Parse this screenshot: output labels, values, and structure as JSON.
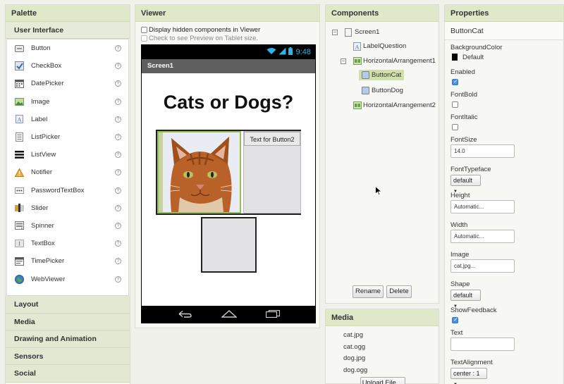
{
  "palette": {
    "title": "Palette",
    "section": "User Interface",
    "items": [
      {
        "label": "Button",
        "icon": "button-icon"
      },
      {
        "label": "CheckBox",
        "icon": "checkbox-icon"
      },
      {
        "label": "DatePicker",
        "icon": "datepicker-icon"
      },
      {
        "label": "Image",
        "icon": "image-icon"
      },
      {
        "label": "Label",
        "icon": "label-icon"
      },
      {
        "label": "ListPicker",
        "icon": "listpicker-icon"
      },
      {
        "label": "ListView",
        "icon": "listview-icon"
      },
      {
        "label": "Notifier",
        "icon": "notifier-icon"
      },
      {
        "label": "PasswordTextBox",
        "icon": "passwordtextbox-icon"
      },
      {
        "label": "Slider",
        "icon": "slider-icon"
      },
      {
        "label": "Spinner",
        "icon": "spinner-icon"
      },
      {
        "label": "TextBox",
        "icon": "textbox-icon"
      },
      {
        "label": "TimePicker",
        "icon": "timepicker-icon"
      },
      {
        "label": "WebViewer",
        "icon": "webviewer-icon"
      }
    ],
    "help_glyph": "?",
    "categories": [
      "Layout",
      "Media",
      "Drawing and Animation",
      "Sensors",
      "Social"
    ]
  },
  "viewer": {
    "title": "Viewer",
    "show_hidden": "Display hidden components in Viewer",
    "tablet_preview": "Check to see Preview on Tablet size.",
    "phone": {
      "time": "9:48",
      "screen_title": "Screen1",
      "question": "Cats or Dogs?",
      "button2_text": "Text for Button2"
    }
  },
  "components": {
    "title": "Components",
    "tree": {
      "screen": "Screen1",
      "label": "LabelQuestion",
      "harr1": "HorizontalArrangement1",
      "btn_cat": "ButtonCat",
      "btn_dog": "ButtonDog",
      "harr2": "HorizontalArrangement2"
    },
    "rename": "Rename",
    "delete": "Delete"
  },
  "media": {
    "title": "Media",
    "files": [
      "cat.jpg",
      "cat.ogg",
      "dog.jpg",
      "dog.ogg"
    ],
    "upload": "Upload File ..."
  },
  "properties": {
    "title": "Properties",
    "component": "ButtonCat",
    "bg_label": "BackgroundColor",
    "bg_value": "Default",
    "enabled_label": "Enabled",
    "fontbold_label": "FontBold",
    "fontitalic_label": "FontItalic",
    "fontsize_label": "FontSize",
    "fontsize_value": "14.0",
    "typeface_label": "FontTypeface",
    "typeface_value": "default",
    "height_label": "Height",
    "height_value": "Automatic...",
    "width_label": "Width",
    "width_value": "Automatic...",
    "image_label": "Image",
    "image_value": "cat.jpg...",
    "shape_label": "Shape",
    "shape_value": "default",
    "feedback_label": "ShowFeedback",
    "text_label": "Text",
    "text_value": "",
    "align_label": "TextAlignment",
    "align_value": "center : 1"
  }
}
